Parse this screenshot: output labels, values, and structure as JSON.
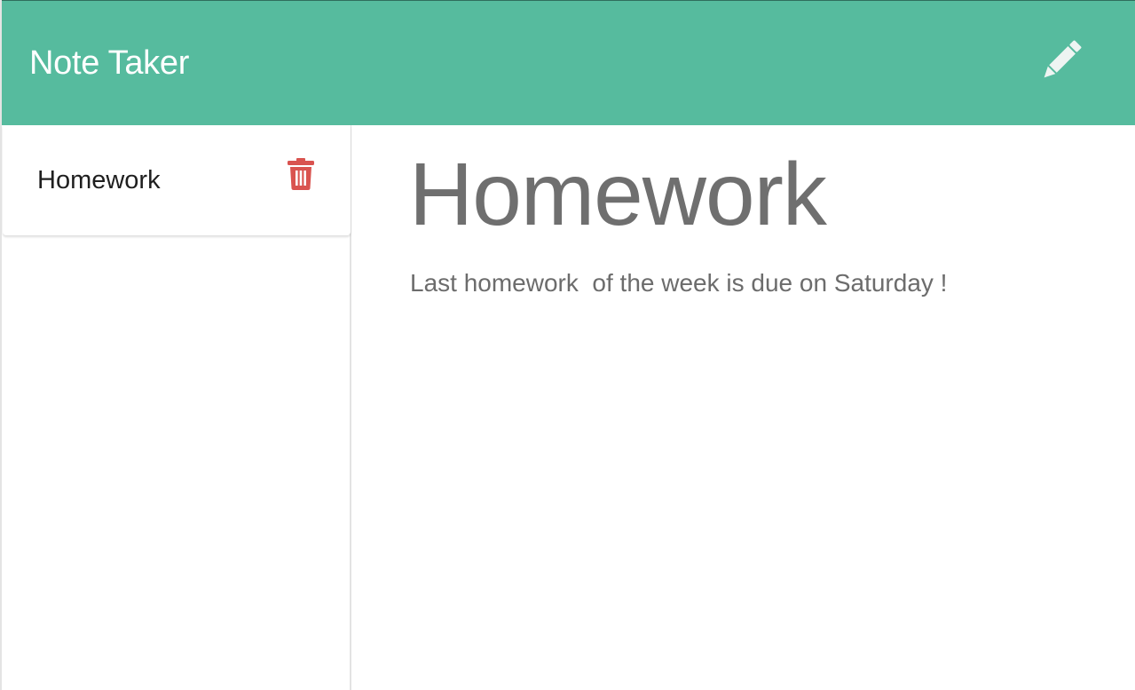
{
  "navbar": {
    "title": "Note Taker",
    "new_note_icon": "pencil-icon",
    "background": "#56bb9e"
  },
  "sidebar": {
    "notes": [
      {
        "title": "Homework",
        "delete_icon": "trash-icon"
      }
    ]
  },
  "active_note": {
    "title": "Homework",
    "text": "Last homework  of the week is due on Saturday !"
  },
  "colors": {
    "accent": "#56bb9e",
    "delete": "#d9534f",
    "pencil": "#eef4f2"
  }
}
